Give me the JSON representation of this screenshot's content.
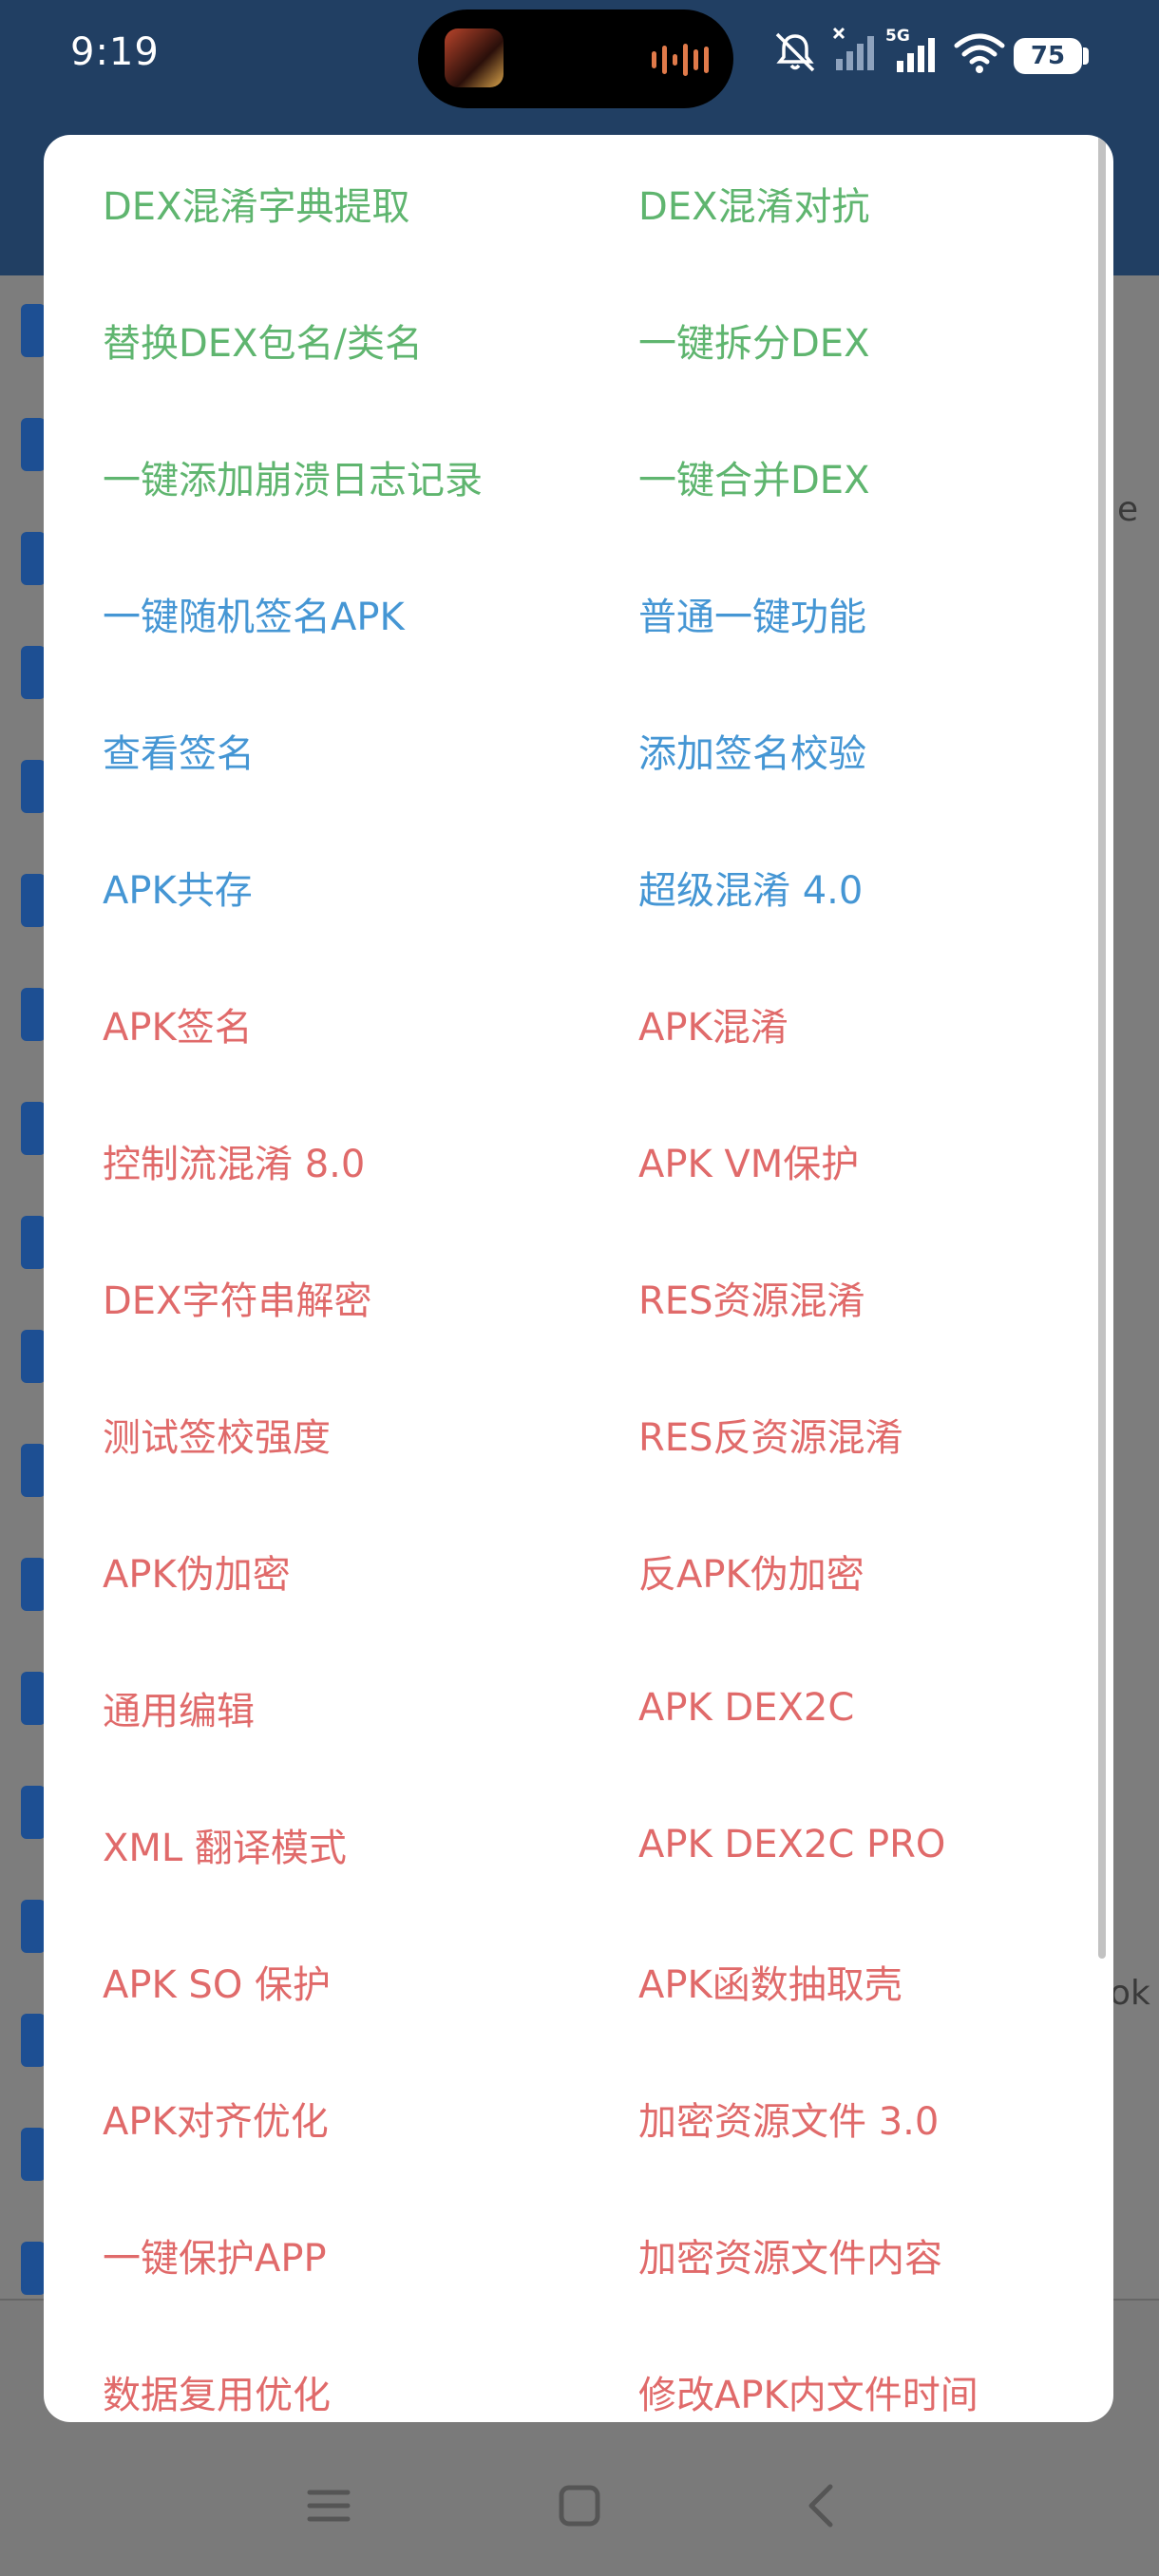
{
  "status_bar": {
    "time": "9:19",
    "battery": "75",
    "network": "5G"
  },
  "colors": {
    "green": "#5fb56f",
    "blue": "#4596d4",
    "red": "#e06a6a",
    "header": "#213f63"
  },
  "background": {
    "edge_text_right_1": "e",
    "edge_text_right_2": "ok"
  },
  "menu": {
    "items": [
      {
        "label": "DEX混淆字典提取",
        "color": "green"
      },
      {
        "label": "DEX混淆对抗",
        "color": "green"
      },
      {
        "label": "替换DEX包名/类名",
        "color": "green"
      },
      {
        "label": "一键拆分DEX",
        "color": "green"
      },
      {
        "label": "一键添加崩溃日志记录",
        "color": "green"
      },
      {
        "label": "一键合并DEX",
        "color": "green"
      },
      {
        "label": "一键随机签名APK",
        "color": "blue"
      },
      {
        "label": "普通一键功能",
        "color": "blue"
      },
      {
        "label": "查看签名",
        "color": "blue"
      },
      {
        "label": "添加签名校验",
        "color": "blue"
      },
      {
        "label": "APK共存",
        "color": "blue"
      },
      {
        "label": "超级混淆 4.0",
        "color": "blue"
      },
      {
        "label": "APK签名",
        "color": "red"
      },
      {
        "label": "APK混淆",
        "color": "red"
      },
      {
        "label": "控制流混淆 8.0",
        "color": "red"
      },
      {
        "label": "APK VM保护",
        "color": "red"
      },
      {
        "label": "DEX字符串解密",
        "color": "red"
      },
      {
        "label": "RES资源混淆",
        "color": "red"
      },
      {
        "label": "测试签校强度",
        "color": "red"
      },
      {
        "label": "RES反资源混淆",
        "color": "red"
      },
      {
        "label": "APK伪加密",
        "color": "red"
      },
      {
        "label": "反APK伪加密",
        "color": "red"
      },
      {
        "label": "通用编辑",
        "color": "red"
      },
      {
        "label": "APK DEX2C",
        "color": "red"
      },
      {
        "label": "XML 翻译模式",
        "color": "red"
      },
      {
        "label": "APK DEX2C PRO",
        "color": "red"
      },
      {
        "label": "APK SO 保护",
        "color": "red"
      },
      {
        "label": "APK函数抽取壳",
        "color": "red"
      },
      {
        "label": "APK对齐优化",
        "color": "red"
      },
      {
        "label": "加密资源文件 3.0",
        "color": "red"
      },
      {
        "label": "一键保护APP",
        "color": "red"
      },
      {
        "label": "加密资源文件内容",
        "color": "red"
      },
      {
        "label": "数据复用优化",
        "color": "red"
      },
      {
        "label": "修改APK内文件时间",
        "color": "red"
      }
    ]
  },
  "nav": {
    "icons": [
      "menu-icon",
      "home-icon",
      "back-icon"
    ]
  }
}
